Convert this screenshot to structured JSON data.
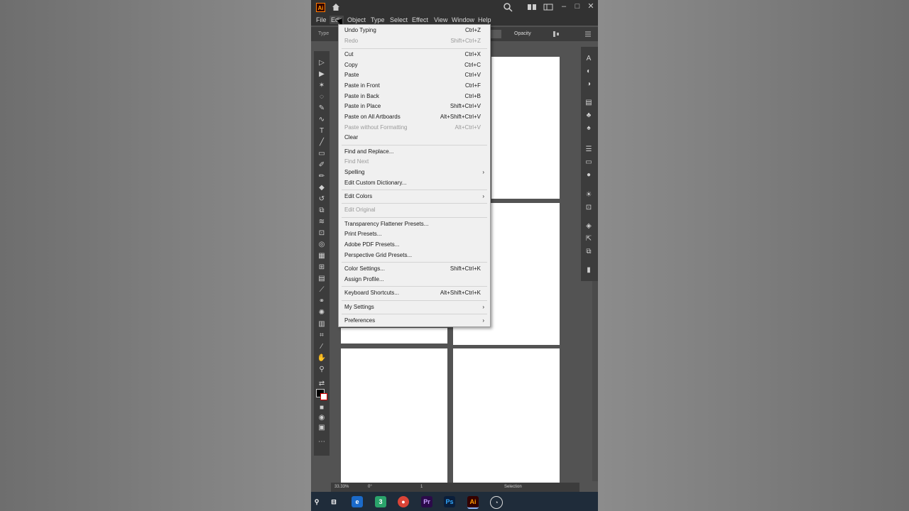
{
  "app": {
    "logo": "Ai",
    "menus": [
      "File",
      "Edit",
      "Object",
      "Type",
      "Select",
      "Effect",
      "View",
      "Window",
      "Help"
    ],
    "active_menu": "Edit",
    "control_bar": {
      "type_label": "Type",
      "opacity_label": "Opacity"
    }
  },
  "edit_menu": {
    "items": [
      {
        "label": "Undo Typing",
        "shortcut": "Ctrl+Z",
        "disabled": false
      },
      {
        "label": "Redo",
        "shortcut": "Shift+Ctrl+Z",
        "disabled": true
      },
      {
        "label": "Cut",
        "shortcut": "Ctrl+X",
        "disabled": false
      },
      {
        "label": "Copy",
        "shortcut": "Ctrl+C",
        "disabled": false
      },
      {
        "label": "Paste",
        "shortcut": "Ctrl+V",
        "disabled": false
      },
      {
        "label": "Paste in Front",
        "shortcut": "Ctrl+F",
        "disabled": false
      },
      {
        "label": "Paste in Back",
        "shortcut": "Ctrl+B",
        "disabled": false
      },
      {
        "label": "Paste in Place",
        "shortcut": "Shift+Ctrl+V",
        "disabled": false
      },
      {
        "label": "Paste on All Artboards",
        "shortcut": "Alt+Shift+Ctrl+V",
        "disabled": false
      },
      {
        "label": "Paste without Formatting",
        "shortcut": "Alt+Ctrl+V",
        "disabled": true
      },
      {
        "label": "Clear",
        "shortcut": "",
        "disabled": false
      },
      {
        "label": "Find and Replace...",
        "shortcut": "",
        "disabled": false
      },
      {
        "label": "Find Next",
        "shortcut": "",
        "disabled": true
      },
      {
        "label": "Spelling",
        "shortcut": "",
        "disabled": false,
        "submenu": true
      },
      {
        "label": "Edit Custom Dictionary...",
        "shortcut": "",
        "disabled": false
      },
      {
        "label": "Edit Colors",
        "shortcut": "",
        "disabled": false,
        "submenu": true
      },
      {
        "label": "Edit Original",
        "shortcut": "",
        "disabled": true
      },
      {
        "label": "Transparency Flattener Presets...",
        "shortcut": "",
        "disabled": false
      },
      {
        "label": "Print Presets...",
        "shortcut": "",
        "disabled": false
      },
      {
        "label": "Adobe PDF Presets...",
        "shortcut": "",
        "disabled": false
      },
      {
        "label": "Perspective Grid Presets...",
        "shortcut": "",
        "disabled": false
      },
      {
        "label": "Color Settings...",
        "shortcut": "Shift+Ctrl+K",
        "disabled": false
      },
      {
        "label": "Assign Profile...",
        "shortcut": "",
        "disabled": false
      },
      {
        "label": "Keyboard Shortcuts...",
        "shortcut": "Alt+Shift+Ctrl+K",
        "disabled": false
      },
      {
        "label": "My Settings",
        "shortcut": "",
        "disabled": false,
        "submenu": true
      },
      {
        "label": "Preferences",
        "shortcut": "",
        "disabled": false,
        "submenu": true
      }
    ]
  },
  "status_bar": {
    "zoom": "33.33%",
    "rotation": "0°",
    "artboard": "1",
    "tool": "Selection"
  },
  "taskbar": {
    "apps": [
      "edge",
      "chrome",
      "premiere",
      "photoshop",
      "illustrator",
      "other"
    ]
  },
  "colors": {
    "accent": "#ff9a00",
    "menu_bg": "#f0f0f0",
    "ui_dark": "#323232",
    "canvas": "#535353"
  }
}
